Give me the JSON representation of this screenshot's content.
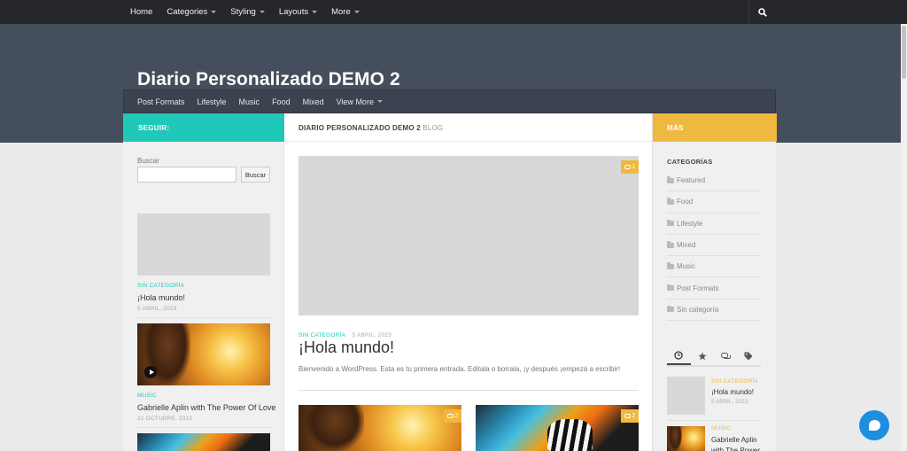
{
  "topnav": {
    "items": [
      {
        "label": "Home",
        "caret": false
      },
      {
        "label": "Categories",
        "caret": true
      },
      {
        "label": "Styling",
        "caret": true
      },
      {
        "label": "Layouts",
        "caret": true
      },
      {
        "label": "More",
        "caret": true
      }
    ]
  },
  "site": {
    "title": "Diario Personalizado DEMO 2"
  },
  "subnav": {
    "items": [
      "Post Formats",
      "Lifestyle",
      "Music",
      "Food",
      "Mixed"
    ],
    "more_label": "View More"
  },
  "left": {
    "header": "SEGUIR:",
    "search_label": "Buscar",
    "search_button": "Buscar",
    "posts": [
      {
        "category": "SIN CATEGORÍA",
        "title": "¡Hola mundo!",
        "date": "5 ABRIL, 2023"
      },
      {
        "category": "MUSIC",
        "title": "Gabrielle Aplin with The Power Of Love",
        "date": "31 OCTUBRE, 2013"
      }
    ]
  },
  "center": {
    "header_strong": "DIARIO PERSONALIZADO DEMO 2",
    "header_light": "BLOG",
    "featured": {
      "comments": "1",
      "category": "SIN CATEGORÍA",
      "date": "5 ABRIL, 2023",
      "title": "¡Hola mundo!",
      "excerpt": "Bienvenido a WordPress. Esta es tu primera entrada. Editala o borrala, ¡y después ¡empezá a escribir!"
    },
    "grid": [
      {
        "comments": "2"
      },
      {
        "comments": "2"
      }
    ]
  },
  "right": {
    "header": "MÁS",
    "categories_title": "CATEGORÍAS",
    "categories": [
      "Featured",
      "Food",
      "Lifestyle",
      "Mixed",
      "Music",
      "Post Formats",
      "Sin categoría"
    ],
    "tab_icons": [
      "clock-icon",
      "star-icon",
      "comments-icon",
      "tags-icon"
    ],
    "posts": [
      {
        "category": "SIN CATEGORÍA",
        "title": "¡Hola mundo!",
        "date": "5 ABRIL, 2023"
      },
      {
        "category": "MUSIC",
        "title": "Gabrielle Aplin with The Power"
      }
    ]
  },
  "colors": {
    "teal": "#1fc8b8",
    "yellow": "#efb93f",
    "header_bg": "#454e5c",
    "topbar_bg": "#26272b",
    "chat_blue": "#1e8fe0"
  }
}
